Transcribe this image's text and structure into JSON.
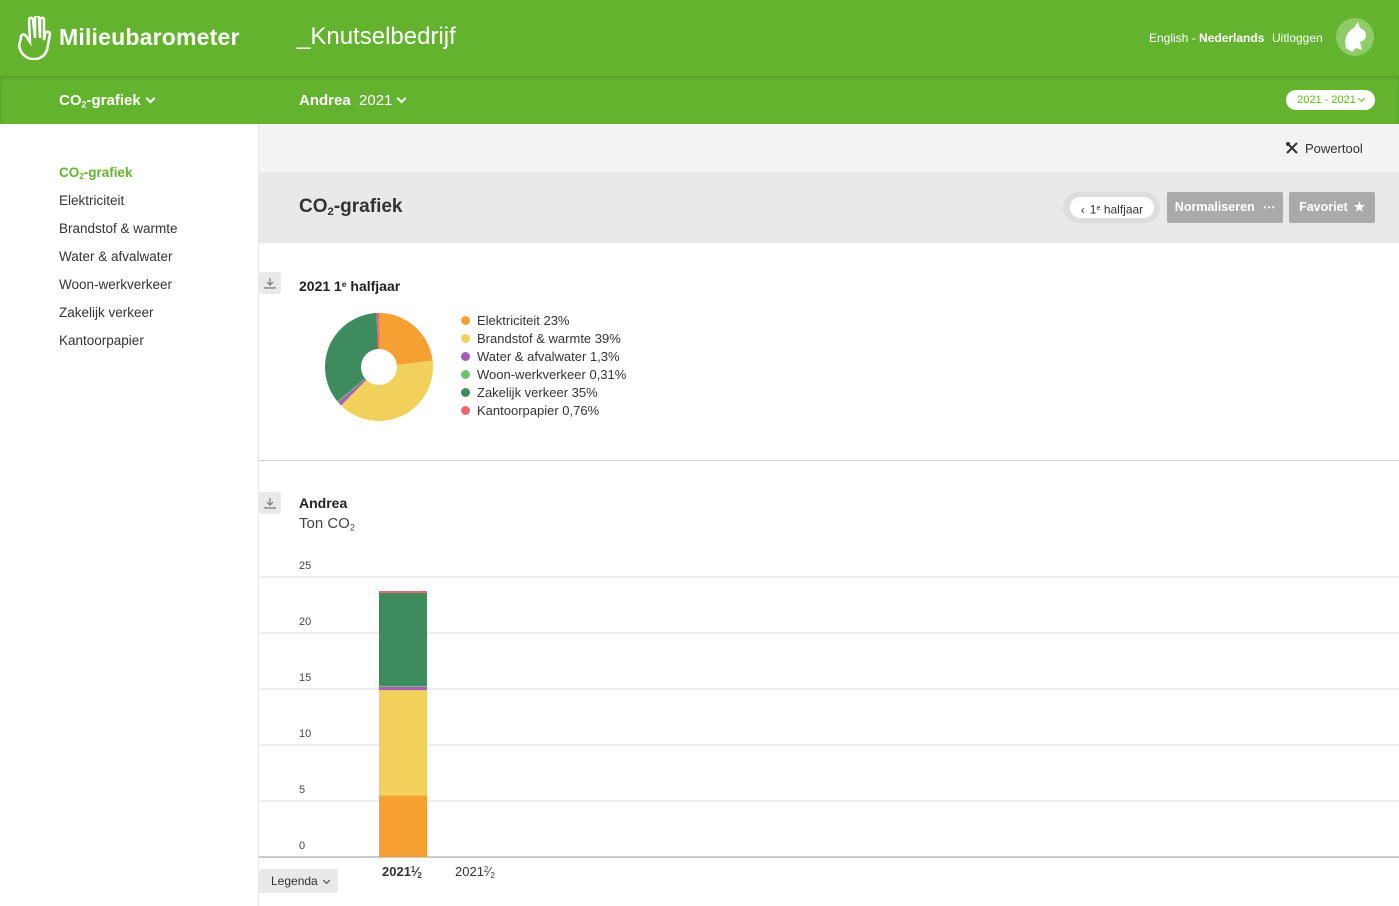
{
  "header": {
    "brand": "Milieubarometer",
    "company": "_Knutselbedrijf",
    "lang_english": "English",
    "lang_sep": " - ",
    "lang_dutch": "Nederlands",
    "logout": "Uitloggen"
  },
  "subbar": {
    "view_prefix": "CO",
    "view_sub": "2",
    "view_suffix": "-grafiek",
    "location": "Andrea",
    "year": "2021",
    "period": "2021 - 2021"
  },
  "sidebar": {
    "items": [
      {
        "prefix": "CO",
        "sub": "2",
        "suffix": "-grafiek",
        "active": true
      },
      {
        "label": "Elektriciteit"
      },
      {
        "label": "Brandstof & warmte"
      },
      {
        "label": "Water & afvalwater"
      },
      {
        "label": "Woon-werkverkeer"
      },
      {
        "label": "Zakelijk verkeer"
      },
      {
        "label": "Kantoorpapier"
      }
    ]
  },
  "toolbar": {
    "powertool": "Powertool"
  },
  "page": {
    "title_prefix": "CO",
    "title_sub": "2",
    "title_suffix": "-grafiek",
    "half_num": "1",
    "half_sup": "e",
    "half_label": " halfjaar",
    "normalize_label": "Normaliseren",
    "favorite_label": "Favoriet"
  },
  "pie_chart": {
    "title_year": "2021 1",
    "title_sup": "e",
    "title_rest": " halfjaar"
  },
  "bar_chart": {
    "title": "Andrea",
    "unit_prefix": "Ton CO",
    "unit_sub": "2",
    "legend_button": "Legenda",
    "x_labels": [
      {
        "year": "2021",
        "num": "1",
        "den": "2",
        "bold": true
      },
      {
        "year": "2021",
        "num": "2",
        "den": "2",
        "bold": false
      }
    ]
  },
  "chart_data": [
    {
      "type": "pie",
      "title": "2021 1e halfjaar",
      "donut": true,
      "slices": [
        {
          "label": "Elektriciteit 23%",
          "name": "Elektriciteit",
          "value": 23,
          "color": "#f6a034"
        },
        {
          "label": "Brandstof & warmte 39%",
          "name": "Brandstof & warmte",
          "value": 39,
          "color": "#f1d15c"
        },
        {
          "label": "Water & afvalwater 1,3%",
          "name": "Water & afvalwater",
          "value": 1.3,
          "color": "#a061b6"
        },
        {
          "label": "Woon-werkverkeer 0,31%",
          "name": "Woon-werkverkeer",
          "value": 0.31,
          "color": "#6cc06e"
        },
        {
          "label": "Zakelijk verkeer 35%",
          "name": "Zakelijk verkeer",
          "value": 35,
          "color": "#3e8c5e"
        },
        {
          "label": "Kantoorpapier 0,76%",
          "name": "Kantoorpapier",
          "value": 0.76,
          "color": "#e8696f"
        }
      ]
    },
    {
      "type": "bar",
      "stacked": true,
      "title": "Andrea",
      "ylabel": "Ton CO2",
      "categories": [
        "2021 1/2",
        "2021 2/2"
      ],
      "ylim": [
        0,
        25
      ],
      "yticks": [
        0,
        5,
        10,
        15,
        20,
        25
      ],
      "grid": true,
      "series": [
        {
          "name": "Elektriciteit",
          "color": "#f6a034",
          "values": [
            5.5,
            0
          ]
        },
        {
          "name": "Brandstof & warmte",
          "color": "#f1d15c",
          "values": [
            9.4,
            0
          ]
        },
        {
          "name": "Water & afvalwater",
          "color": "#a061b6",
          "values": [
            0.3,
            0
          ]
        },
        {
          "name": "Woon-werkverkeer",
          "color": "#6cc06e",
          "values": [
            0.07,
            0
          ]
        },
        {
          "name": "Zakelijk verkeer",
          "color": "#3e8c5e",
          "values": [
            8.3,
            0
          ]
        },
        {
          "name": "Kantoorpapier",
          "color": "#e8696f",
          "values": [
            0.18,
            0
          ]
        }
      ]
    }
  ]
}
